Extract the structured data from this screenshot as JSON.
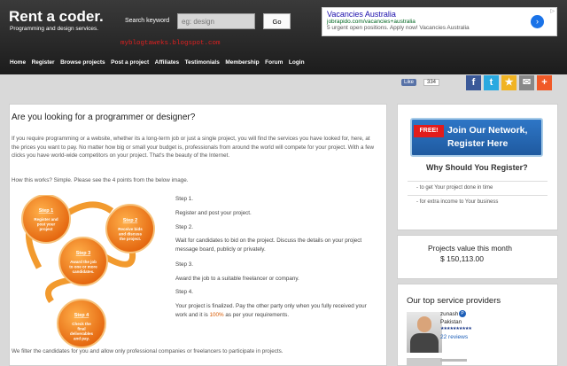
{
  "header": {
    "brand": "Rent a coder.",
    "tagline": "Programming and design services.",
    "search_label": "Search keyword",
    "search_placeholder": "eg: design",
    "go_label": "Go",
    "blog_watermark": "myblogtaweks.blogspot.com"
  },
  "ad": {
    "title": "Vacancies Australia",
    "url": "jobrapido.com/vacancies+australia",
    "desc": "5 urgent open positions. Apply now! Vacancies Australia",
    "arrow": "›",
    "adchoices": "▷"
  },
  "nav": [
    "Home",
    "Register",
    "Browse projects",
    "Post a project",
    "Affiliates",
    "Testimonials",
    "Membership",
    "Forum",
    "Login"
  ],
  "social": {
    "like_label": "Like",
    "like_count": "334",
    "buttons": [
      {
        "glyph": "f",
        "color": "#3b5998"
      },
      {
        "glyph": "t",
        "color": "#2aa9e0"
      },
      {
        "glyph": "★",
        "color": "#f0b322"
      },
      {
        "glyph": "✉",
        "color": "#888888"
      },
      {
        "glyph": "+",
        "color": "#f05a28"
      }
    ]
  },
  "main": {
    "heading": "Are you looking for a programmer or designer?",
    "intro": "If you require programming or a website, whether its a long-term job or just a single project, you will find the services you have looked for, here, at the prices you want to pay. No matter how big or small your budget is, professionals from around the world will compete for your project. With a few clicks you have world-wide competitors on your project. That's the beauty of the Internet.",
    "how": "How this works? Simple. Please see the 4 points from the below image.",
    "steps": [
      {
        "title": "Step 1.",
        "text": "Register and post your project."
      },
      {
        "title": "Step 2.",
        "text": "Wait for candidates to bid on the project. Discuss the details on your project message board, publicly or privately."
      },
      {
        "title": "Step 3.",
        "text": "Award the job to a suitable freelancer or company."
      },
      {
        "title": "Step 4.",
        "text_before": "Your project is finalized. Pay the other party only when you fully received your work and it is ",
        "pct": "100%",
        "text_after": " as per your requirements."
      }
    ],
    "filter_text": "We filter the candidates for you and allow only professional companies or freelancers to participate in projects.",
    "diagram": [
      {
        "title": "Step 1",
        "text": "Register and post your project"
      },
      {
        "title": "Step 2",
        "text": "Receive bids and discuss the project."
      },
      {
        "title": "Step 3",
        "text": "Award the job to one or more candidates."
      },
      {
        "title": "Step 4",
        "text": "Check the final deliverables and pay."
      }
    ]
  },
  "sidebar": {
    "banner_free": "FREE!",
    "banner_line1": "Join Our Network,",
    "banner_line2": "Register Here",
    "why": "Why Should You Register?",
    "reasons": [
      "- to get Your project done in time",
      "- for extra income to Your business"
    ],
    "projects_label": "Projects value this month",
    "projects_value": "$ 150,113.00",
    "top_title": "Our top service providers",
    "provider": {
      "name": "zunash",
      "badge": "P",
      "country": "Pakistan",
      "stars": "★★★★★★★★★★",
      "reviews": "22 reviews"
    }
  }
}
